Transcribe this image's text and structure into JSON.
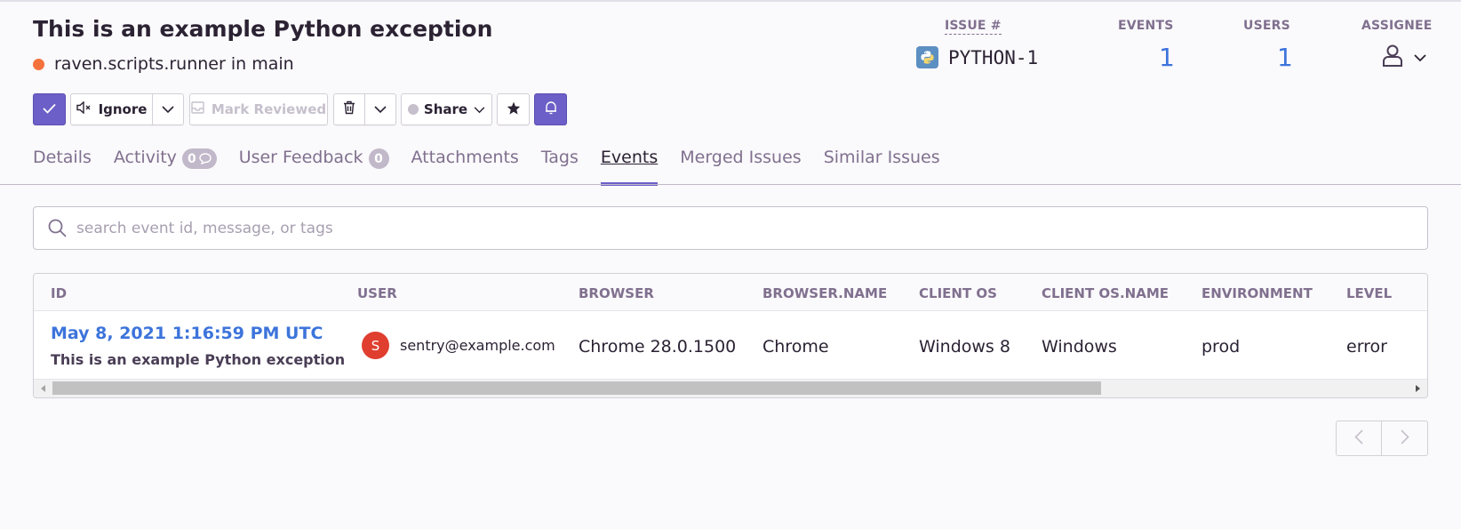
{
  "issue": {
    "title": "This is an example Python exception",
    "culprit": "raven.scripts.runner in main",
    "level_color": "#f5713c"
  },
  "stats": {
    "issue_label": "ISSUE #",
    "short_id": "PYTHON-1",
    "platform_icon": "python-icon",
    "events_label": "EVENTS",
    "events_count": "1",
    "users_label": "USERS",
    "users_count": "1",
    "assignee_label": "ASSIGNEE"
  },
  "toolbar": {
    "resolve_icon": "checkmark-icon",
    "ignore_label": "Ignore",
    "mark_reviewed_label": "Mark Reviewed",
    "share_label": "Share",
    "accent": "#6c5fc7"
  },
  "tabs": [
    {
      "label": "Details"
    },
    {
      "label": "Activity",
      "badge": "0"
    },
    {
      "label": "User Feedback",
      "badge": "0"
    },
    {
      "label": "Attachments"
    },
    {
      "label": "Tags"
    },
    {
      "label": "Events",
      "active": true
    },
    {
      "label": "Merged Issues"
    },
    {
      "label": "Similar Issues"
    }
  ],
  "search": {
    "placeholder": "search event id, message, or tags"
  },
  "table": {
    "columns": [
      "ID",
      "USER",
      "BROWSER",
      "BROWSER.NAME",
      "CLIENT OS",
      "CLIENT OS.NAME",
      "ENVIRONMENT",
      "LEVEL"
    ],
    "rows": [
      {
        "date": "May 8, 2021 1:16:59 PM UTC",
        "message": "This is an example Python exception",
        "user_initial": "S",
        "user_email": "sentry@example.com",
        "browser": "Chrome 28.0.1500",
        "browser_name": "Chrome",
        "client_os": "Windows 8",
        "client_os_name": "Windows",
        "environment": "prod",
        "level": "error"
      }
    ]
  },
  "pagination": {
    "prev_icon": "chevron-left-icon",
    "next_icon": "chevron-right-icon"
  }
}
